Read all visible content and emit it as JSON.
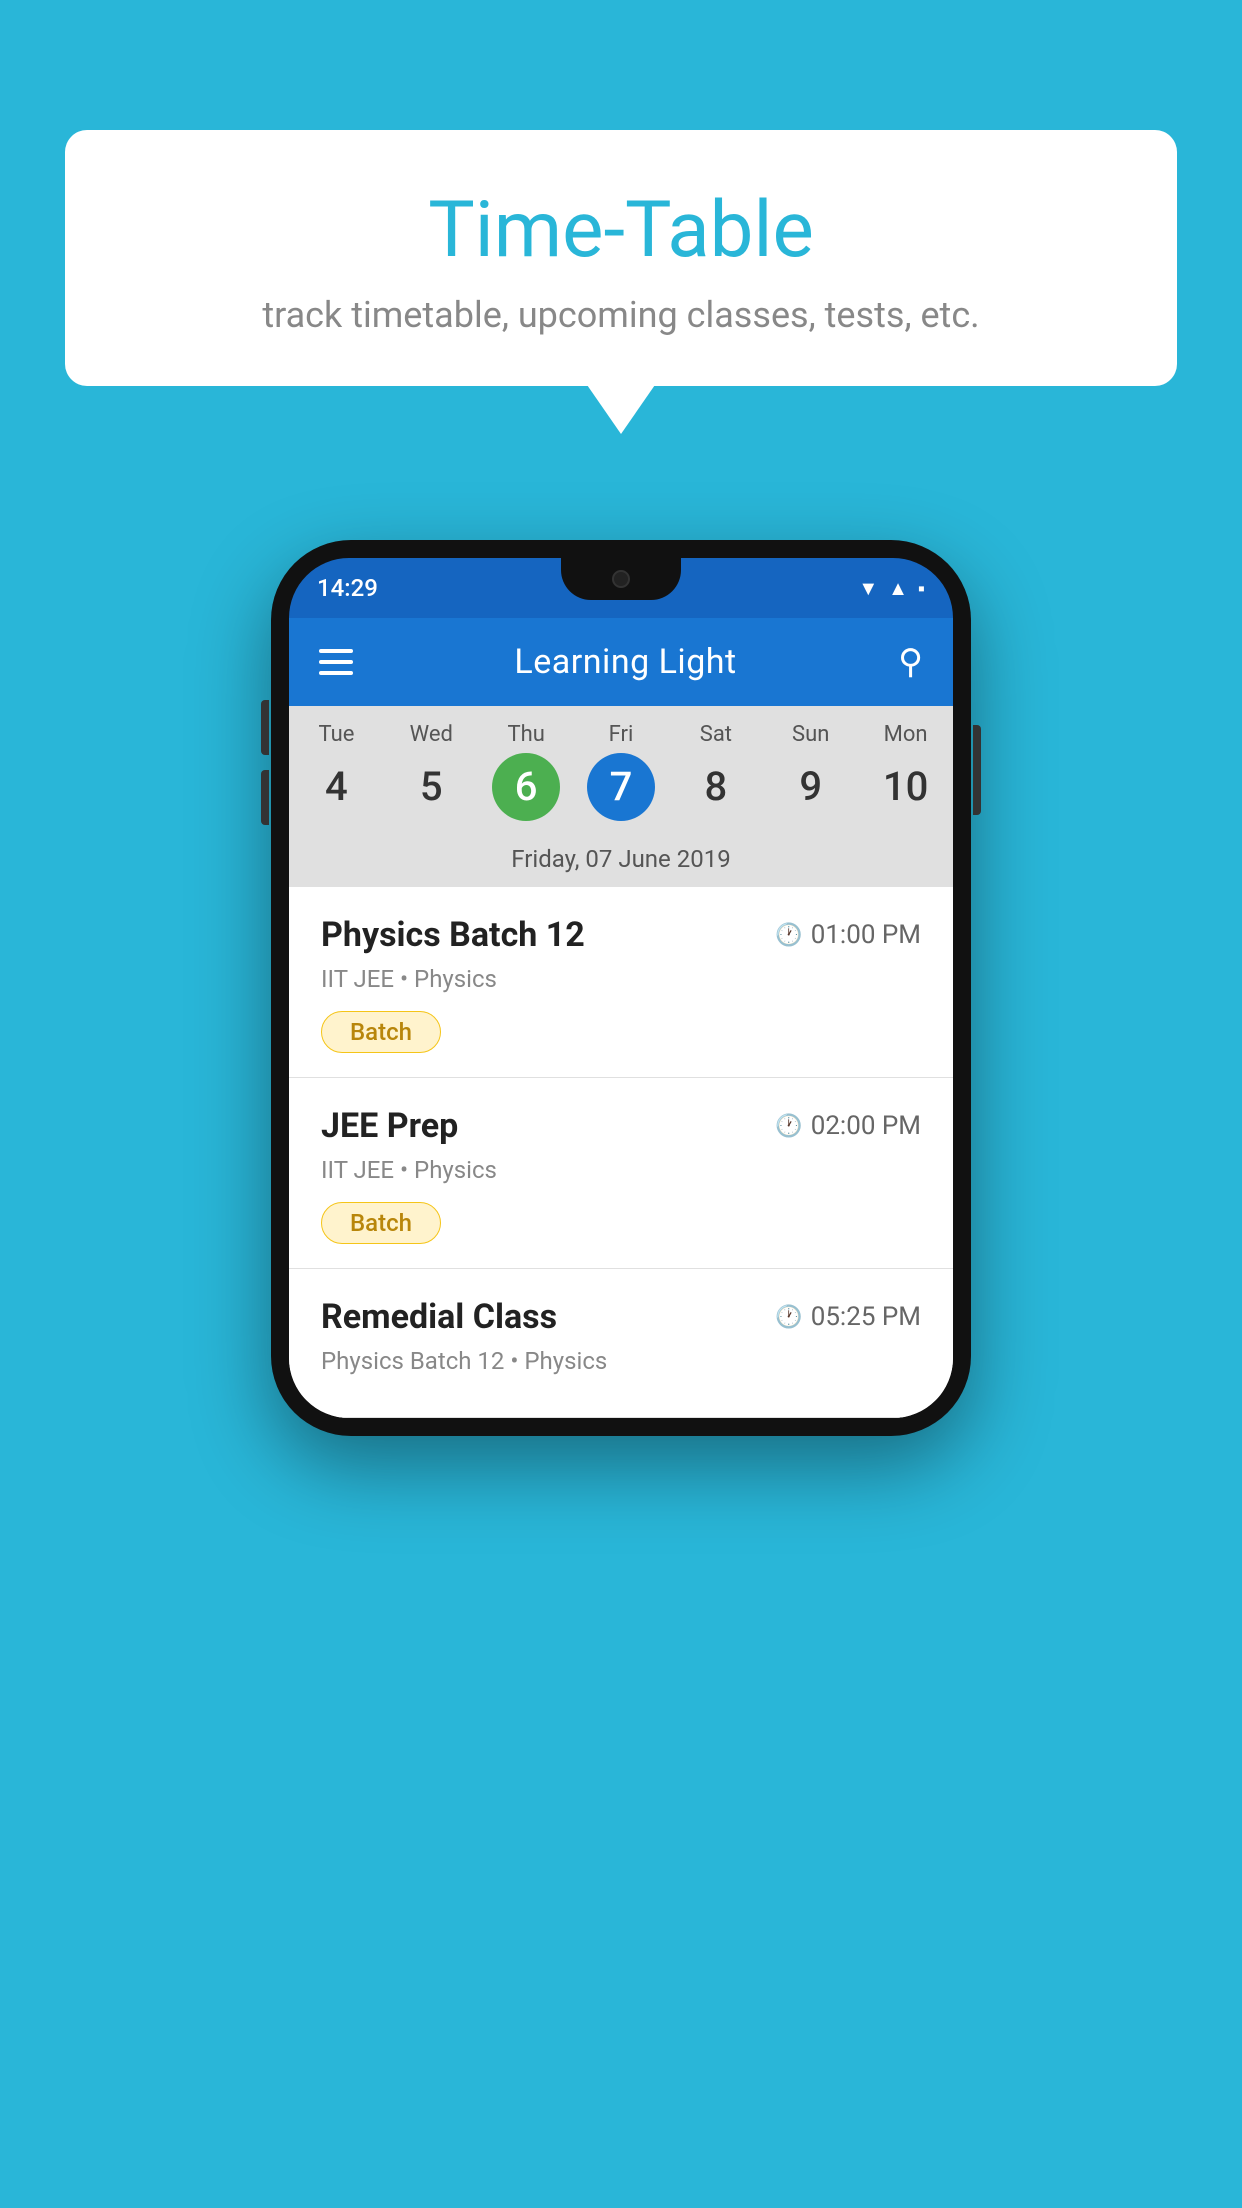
{
  "background_color": "#29B6D8",
  "bubble": {
    "title": "Time-Table",
    "subtitle": "track timetable, upcoming classes, tests, etc."
  },
  "phone": {
    "status_bar": {
      "time": "14:29"
    },
    "app_bar": {
      "title": "Learning Light"
    },
    "calendar": {
      "days": [
        {
          "name": "Tue",
          "num": "4",
          "state": "normal"
        },
        {
          "name": "Wed",
          "num": "5",
          "state": "normal"
        },
        {
          "name": "Thu",
          "num": "6",
          "state": "today"
        },
        {
          "name": "Fri",
          "num": "7",
          "state": "selected"
        },
        {
          "name": "Sat",
          "num": "8",
          "state": "normal"
        },
        {
          "name": "Sun",
          "num": "9",
          "state": "normal"
        },
        {
          "name": "Mon",
          "num": "10",
          "state": "normal"
        }
      ],
      "selected_date_label": "Friday, 07 June 2019"
    },
    "classes": [
      {
        "name": "Physics Batch 12",
        "time": "01:00 PM",
        "meta": "IIT JEE • Physics",
        "badge": "Batch"
      },
      {
        "name": "JEE Prep",
        "time": "02:00 PM",
        "meta": "IIT JEE • Physics",
        "badge": "Batch"
      },
      {
        "name": "Remedial Class",
        "time": "05:25 PM",
        "meta": "Physics Batch 12 • Physics",
        "badge": null
      }
    ]
  }
}
